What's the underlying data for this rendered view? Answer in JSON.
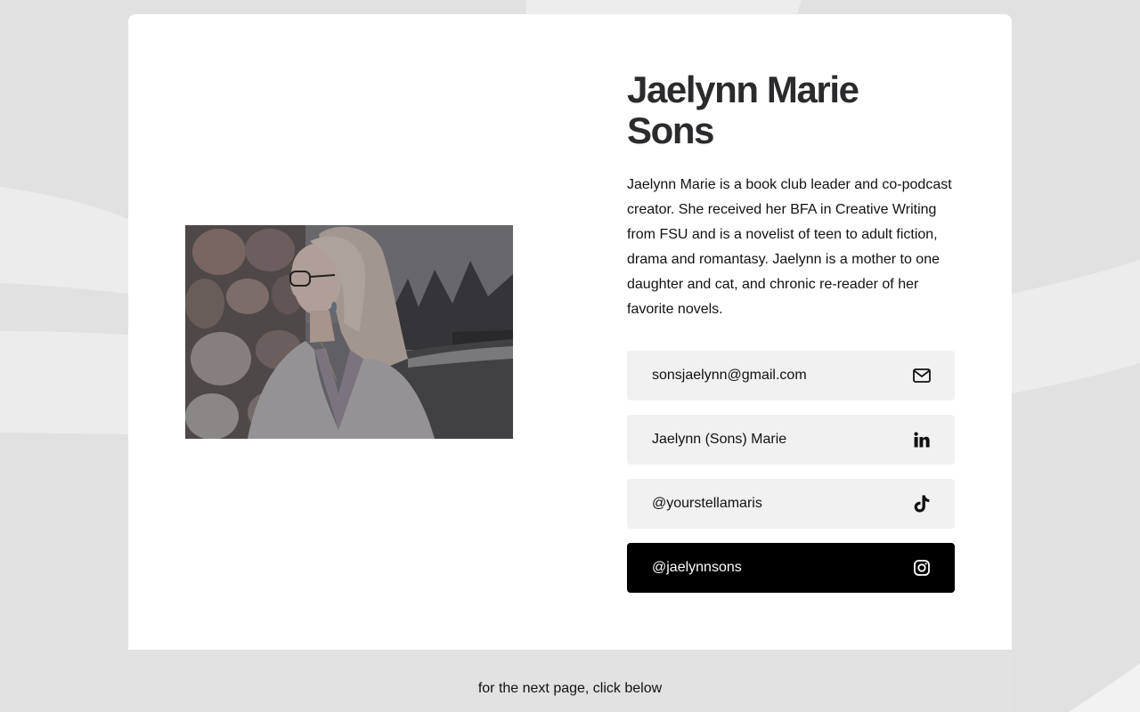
{
  "profile": {
    "name": "Jaelynn Marie Sons",
    "bio": "Jaelynn Marie is a book club leader and co-podcast creator. She received her BFA in Creative Writing from FSU and is a novelist of teen to adult fiction, drama and romantasy. Jaelynn is a mother to one daughter and cat, and chronic re-reader of her favorite novels."
  },
  "links": [
    {
      "label": "sonsjaelynn@gmail.com",
      "icon": "mail-icon"
    },
    {
      "label": "Jaelynn (Sons) Marie",
      "icon": "linkedin-icon"
    },
    {
      "label": "@yourstellamaris",
      "icon": "tiktok-icon"
    },
    {
      "label": "@jaelynnsons",
      "icon": "instagram-icon"
    }
  ],
  "footer": {
    "text": "for the next page, click below"
  },
  "colors": {
    "page_background": "#e1e1e1",
    "card": "#ffffff",
    "link_button": "#f1f1f1",
    "link_button_active": "#000000",
    "heading": "#2b2b2e"
  }
}
